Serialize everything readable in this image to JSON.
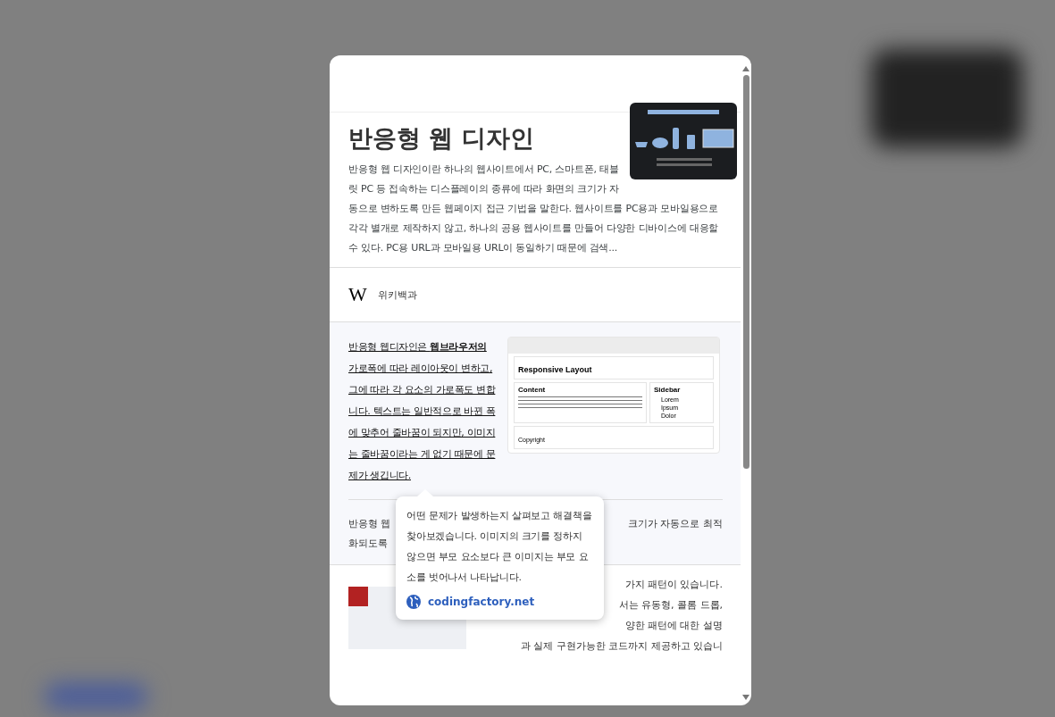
{
  "card": {
    "title": "반응형 웹 디자인",
    "description": "반응형 웹 디자인이란 하나의 웹사이트에서 PC, 스마트폰, 태블릿 PC 등 접속하는 디스플레이의 종류에 따라 화면의 크기가 자동으로 변하도록 만든 웹페이지 접근 기법을 말한다. 웹사이트를 PC용과 모바일용으로 각각 별개로 제작하지 않고, 하나의 공용 웹사이트를 만들어 다양한 디바이스에 대응할 수 있다. PC용 URL과 모바일용 URL이 동일하기 때문에 검색...",
    "source_logo": "W",
    "source": "위키백과"
  },
  "featured": {
    "text": "반응형 웹디자인은 **웹브라우저의** 가로폭에 따라 레이아웃이 변하고, 그에 따라 각 요소의 가로폭도 변합니다. 텍스트는 일반적으로 바뀐 폭에 맞추어 줄바꿈이 되지만, 이미지는 줄바꿈이라는 게 없기 때문에 문제가 생깁니다.",
    "screenshot": {
      "heading": "Responsive Layout",
      "content_heading": "Content",
      "sidebar_heading": "Sidebar",
      "sidebar_items": [
        "Lorem",
        "Ipsum",
        "Dolor"
      ],
      "footer": "Copyright"
    }
  },
  "snippet": {
    "line_1_start": "반응형 웹",
    "line_1_end": "크기가 자동으로 최적",
    "line_2_start": "화되도록"
  },
  "result": {
    "lines": [
      "가지 패턴이 있습니다.",
      "서는 유동형, 콜롬 드롭,",
      "양한 패턴에 대한 설명",
      "과 실제 구현가능한 코드까지 제공하고 있습니"
    ]
  },
  "tooltip": {
    "text": "어떤 문제가 발생하는지 살펴보고 해결책을 찾아보겠습니다. 이미지의 크기를 정하지 않으면 부모 요소보다 큰 이미지는 부모 요소를 벗어나서 나타납니다.",
    "link": "codingfactory.net"
  }
}
